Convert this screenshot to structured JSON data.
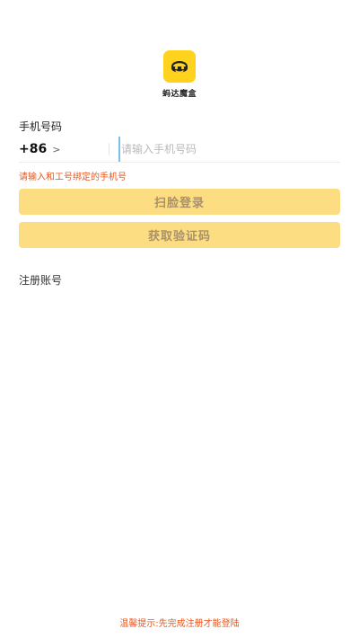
{
  "brand": {
    "name": "蚂达魔盒",
    "color": "#FFD21E"
  },
  "phone": {
    "label": "手机号码",
    "country_code": "+86",
    "placeholder": "请输入手机号码",
    "value": ""
  },
  "hint": "请输入和工号绑定的手机号",
  "buttons": {
    "face_login": "扫脸登录",
    "get_code": "获取验证码",
    "color": "#FCDD82"
  },
  "register_link": "注册账号",
  "footer_tip": "温馨提示:先完成注册才能登陆",
  "accent_color": "#E8571E"
}
